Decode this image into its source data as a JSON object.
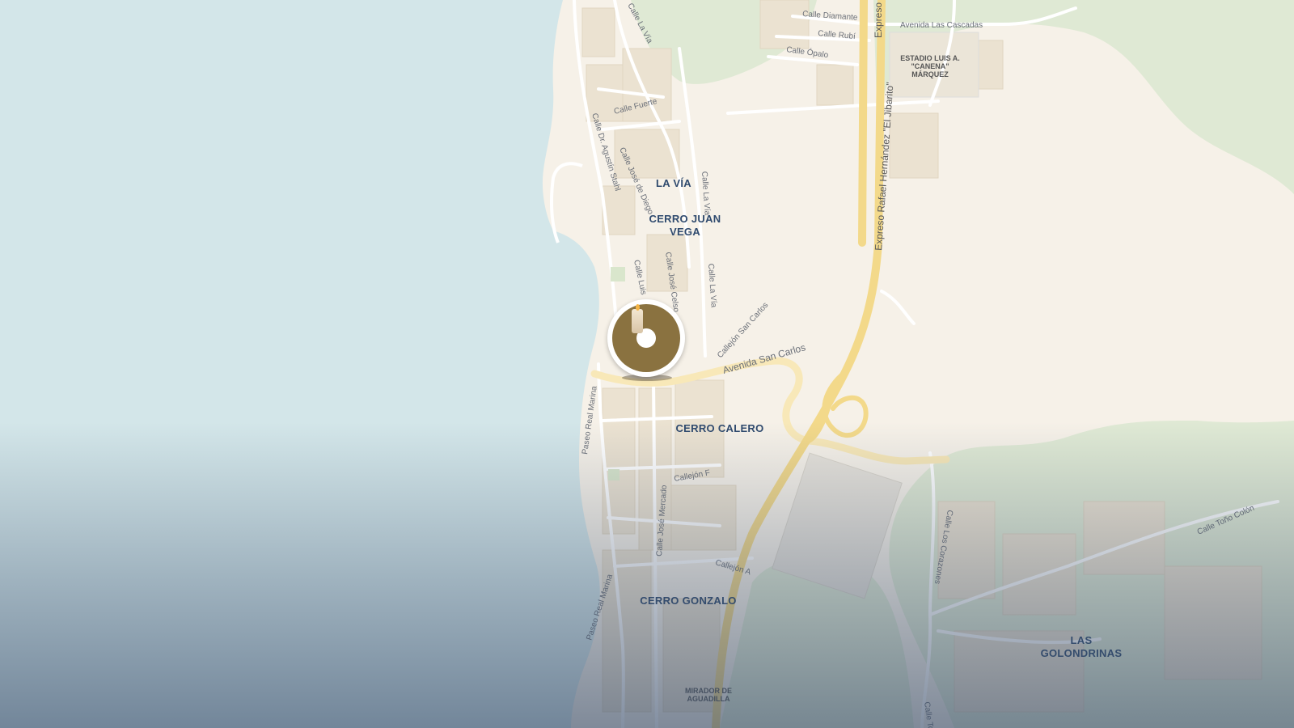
{
  "map": {
    "neighborhoods": {
      "la_via": "LA VÍA",
      "cerro_juan_vega_1": "CERRO JUAN",
      "cerro_juan_vega_2": "VEGA",
      "cerro_calero": "CERRO CALERO",
      "cerro_gonzalo": "CERRO GONZALO",
      "las_golondrinas_1": "LAS",
      "las_golondrinas_2": "GOLONDRINAS"
    },
    "pois": {
      "estadio_1": "ESTADIO LUIS A.",
      "estadio_2": "\"CANENA\"",
      "estadio_3": "MÁRQUEZ",
      "mirador_1": "MIRADOR DE",
      "mirador_2": "AGUADILLA"
    },
    "streets": {
      "calle_la_via_top": "Calle La Vía",
      "calle_diamante": "Calle Diamante",
      "avenida_las_cascadas": "Avenida Las Cascadas",
      "calle_rubi": "Calle Rubí",
      "calle_opalo": "Calle Ópalo",
      "calle_fuerte": "Calle Fuerte",
      "calle_dr_agustin_stahl": "Calle Dr. Agustín Stahl",
      "calle_jose_de_diego": "Calle José de Diego",
      "calle_la_via_mid": "Calle La Vía",
      "calle_luis": "Calle Luis",
      "calle_jose_celso": "Calle José Celso",
      "calle_la_via_low": "Calle La Vía",
      "callejon_san_carlos": "Callejón San Carlos",
      "avenida_san_carlos": "Avenida San Carlos",
      "paseo_real_marina_1": "Paseo Real Marina",
      "paseo_real_marina_2": "Paseo Real Marina",
      "callejon_f": "Callejón F",
      "calle_jose_mercado": "Calle José Mercado",
      "callejon_a": "Callejón A",
      "calle_los_corazones": "Calle Los Corazones",
      "calle_tono_colon": "Calle Toño Colón",
      "calle_to": "Calle To",
      "expreso_rafael": "Expreso Rafael Hernández \"El Jibarito\"",
      "expreso_top": "Expreso"
    },
    "colors": {
      "water": "#d3e6e9",
      "land": "#f6f1e8",
      "green": "#dfe9d4",
      "highway": "#f3d98a",
      "marker": "#8a7240",
      "label": "#2f4a6e"
    },
    "marker": {
      "icon": "candle-icon"
    }
  }
}
